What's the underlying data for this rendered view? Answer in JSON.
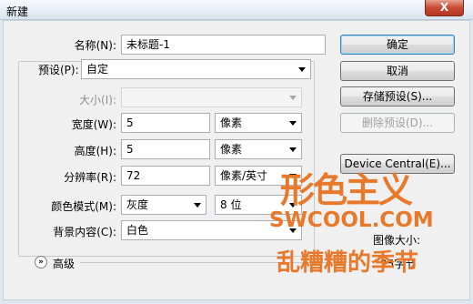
{
  "window": {
    "title": "新建",
    "close_glyph": "X"
  },
  "form": {
    "name": {
      "label": "名称(N):",
      "value": "未标题-1"
    },
    "preset": {
      "label": "预设(P):",
      "value": "自定"
    },
    "size": {
      "label": "大小(I):",
      "value": ""
    },
    "width": {
      "label": "宽度(W):",
      "value": "5",
      "unit": "像素"
    },
    "height": {
      "label": "高度(H):",
      "value": "5",
      "unit": "像素"
    },
    "resolution": {
      "label": "分辨率(R):",
      "value": "72",
      "unit": "像素/英寸"
    },
    "color_mode": {
      "label": "颜色模式(M):",
      "value": "灰度",
      "depth": "8 位"
    },
    "background": {
      "label": "背景内容(C):",
      "value": "白色"
    },
    "advanced": {
      "label": "高级",
      "icon": "double-chevron-down-icon"
    }
  },
  "buttons": {
    "ok": "确定",
    "cancel": "取消",
    "save_preset": "存储预设(S)...",
    "delete_preset": "删除预设(D)...",
    "device_central": "Device Central(E)..."
  },
  "image_size": {
    "label": "图像大小:",
    "value": "25字节"
  },
  "watermark": {
    "logo": "形色主义",
    "site": "SWCOOL.COM",
    "caption": "乱糟糟的季节"
  },
  "colors": {
    "accent": "#e8782a",
    "default_button_border": "#3c7fb1"
  }
}
